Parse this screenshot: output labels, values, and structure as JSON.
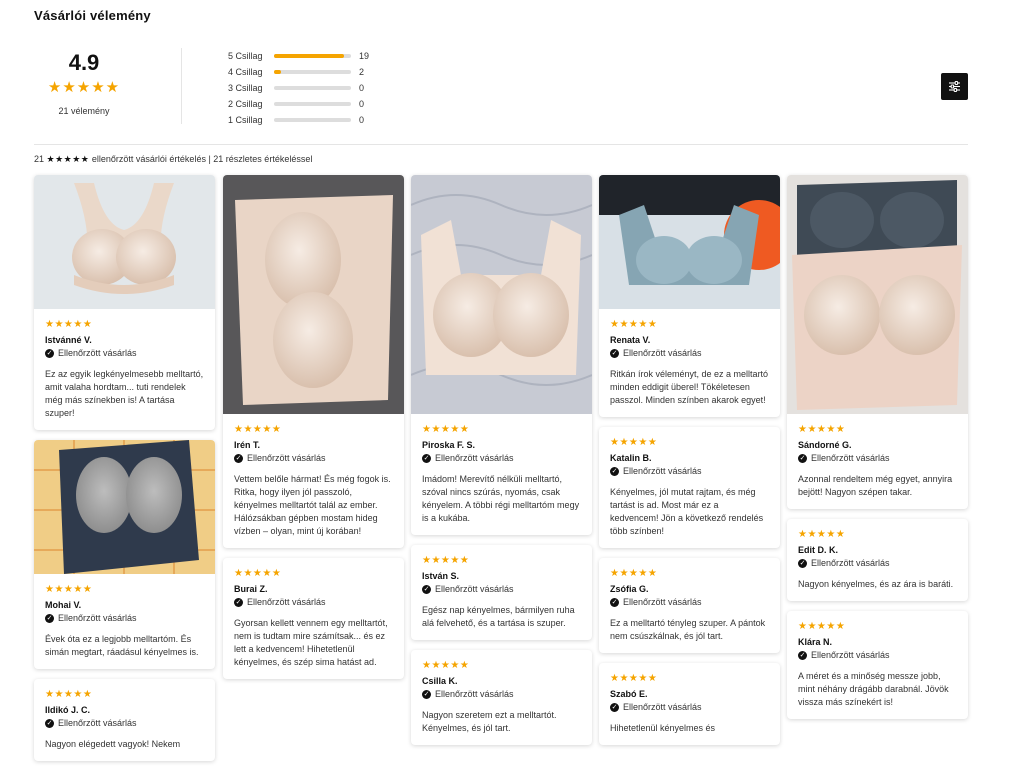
{
  "title": "Vásárlói vélemény",
  "summary": {
    "average": "4.9",
    "average_stars": "★★★★★",
    "review_count": "21 vélemény",
    "histogram": [
      {
        "label": "5 Csillag",
        "count": "19",
        "fraction": 0.905
      },
      {
        "label": "4 Csillag",
        "count": "2",
        "fraction": 0.095
      },
      {
        "label": "3 Csillag",
        "count": "0",
        "fraction": 0
      },
      {
        "label": "2 Csillag",
        "count": "0",
        "fraction": 0
      },
      {
        "label": "1 Csillag",
        "count": "0",
        "fraction": 0
      }
    ],
    "line_prefix": "21",
    "line_stars": "★★★★★",
    "line_rest": "ellenőrzött vásárlói értékelés | 21 részletes értékeléssel"
  },
  "verified_label": "Ellenőrzött vásárlás",
  "review_stars": "★★★★★",
  "columns": [
    [
      {
        "name": "Istvánné V.",
        "text": "Ez az egyik legkényelmesebb melltartó, amit valaha hordtam... tuti rendelek még más színekben is! A tartása szuper!",
        "image": "nude-bra"
      },
      {
        "name": "Mohai V.",
        "text": "Évek óta ez a legjobb melltartóm. És simán megtart, ráadásul kényelmes is.",
        "image": "navy-bra"
      },
      {
        "name": "Ildikó J. C.",
        "text": "Nagyon elégedett vagyok! Nekem",
        "image": ""
      }
    ],
    [
      {
        "name": "Irén T.",
        "text": "Vettem belőle hármat! És még fogok is. Ritka, hogy ilyen jól passzoló, kényelmes melltartót talál az ember. Hálózsákban gépben mostam hideg vízben – olyan, mint új korában!",
        "image": "nude-flat"
      },
      {
        "name": "Burai Z.",
        "text": "Gyorsan kellett vennem egy melltartót, nem is tudtam mire számítsak... és ez lett a kedvencem! Hihetetlenül kényelmes, és szép sima hatást ad.",
        "image": ""
      }
    ],
    [
      {
        "name": "Piroska F. S.",
        "text": "Imádom! Merevítő nélküli melltartó, szóval nincs szúrás, nyomás, csak kényelem. A többi régi melltartóm megy is a kukába.",
        "image": "nude-quilt"
      },
      {
        "name": "István S.",
        "text": "Egész nap kényelmes, bármilyen ruha alá felvehető, és a tartása is szuper.",
        "image": ""
      },
      {
        "name": "Csilla K.",
        "text": "Nagyon szeretem ezt a melltartót. Kényelmes, és jól tart.",
        "image": ""
      }
    ],
    [
      {
        "name": "Renata V.",
        "text": "Ritkán írok véleményt, de ez a melltartó minden eddigit überel! Tökéletesen passzol. Minden színben akarok egyet!",
        "image": "blue-bra"
      },
      {
        "name": "Katalin B.",
        "text": "Kényelmes, jól mutat rajtam, és még tartást is ad. Most már ez a kedvencem! Jön a következő rendelés több színben!",
        "image": ""
      },
      {
        "name": "Zsófia G.",
        "text": "Ez a melltartó tényleg szuper. A pántok nem csúszkálnak, és jól tart.",
        "image": ""
      },
      {
        "name": "Szabó E.",
        "text": "Hihetetlenül kényelmes és",
        "image": ""
      }
    ],
    [
      {
        "name": "Sándorné G.",
        "text": "Azonnal rendeltem még egyet, annyira bejött! Nagyon szépen takar.",
        "image": "two-bras"
      },
      {
        "name": "Edit D. K.",
        "text": "Nagyon kényelmes, és az ára is baráti.",
        "image": ""
      },
      {
        "name": "Klára N.",
        "text": "A méret és a minőség messze jobb, mint néhány drágább darabnál. Jövök vissza más színekért is!",
        "image": ""
      }
    ]
  ]
}
